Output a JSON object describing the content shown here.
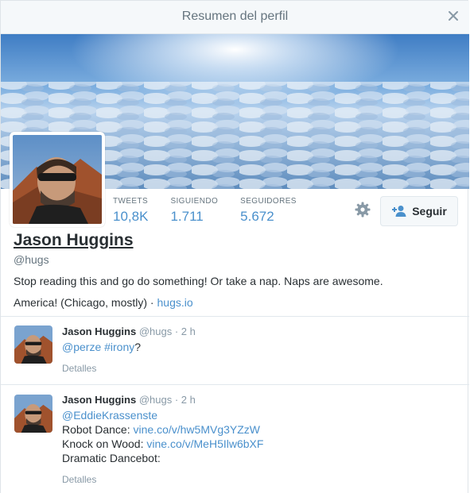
{
  "modal": {
    "title": "Resumen del perfil",
    "close_icon": "close-icon"
  },
  "profile": {
    "name": "Jason Huggins",
    "handle": "@hugs",
    "bio": "Stop reading this and go do something! Or take a nap. Naps are awesome.",
    "location": "America! (Chicago, mostly)",
    "separator": " · ",
    "website": "hugs.io"
  },
  "stats": [
    {
      "label": "TWEETS",
      "value": "10,8K"
    },
    {
      "label": "SIGUIENDO",
      "value": "1.711"
    },
    {
      "label": "SEGUIDORES",
      "value": "5.672"
    }
  ],
  "actions": {
    "follow_label": "Seguir",
    "gear_icon": "gear-icon",
    "follow_icon": "add-user-icon"
  },
  "tweets": [
    {
      "name": "Jason Huggins",
      "handle": "@hugs",
      "dot": "·",
      "time": "2 h",
      "mention": "@perze",
      "hashtag": "#irony",
      "suffix": "?",
      "details": "Detalles"
    },
    {
      "name": "Jason Huggins",
      "handle": "@hugs",
      "dot": "·",
      "time": "2 h",
      "line1": "@EddieKrassenste",
      "line2_prefix": "Robot Dance: ",
      "line2_link": "vine.co/v/hw5MVg3YZzW",
      "line3_prefix": "Knock on Wood: ",
      "line3_link": "vine.co/v/MeH5Ilw6bXF",
      "line4": "Dramatic Dancebot:",
      "details": "Detalles"
    }
  ],
  "colors": {
    "link": "#4a90cc",
    "header_bg": "#f5f8fa",
    "sky_top": "#4f86c4",
    "cloud": "#dde8f3"
  }
}
